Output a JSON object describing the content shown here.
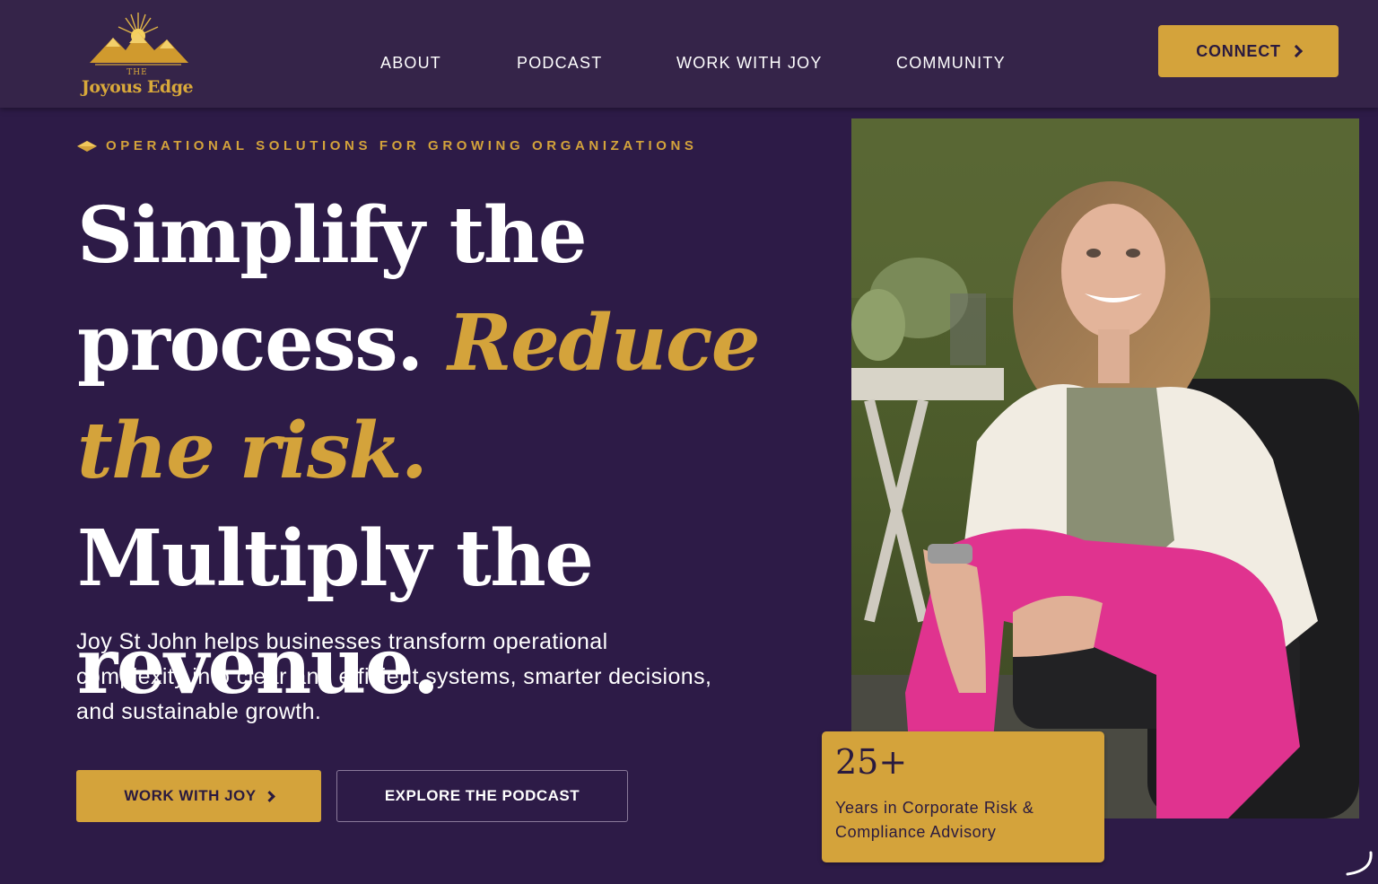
{
  "brand": {
    "logo_the": "THE",
    "logo_name": "Joyous Edge",
    "accent_color": "#d4a33b",
    "background_color": "#2d1b47"
  },
  "nav": {
    "items": [
      {
        "label": "ABOUT"
      },
      {
        "label": "PODCAST"
      },
      {
        "label": "WORK WITH JOY"
      },
      {
        "label": "COMMUNITY"
      }
    ],
    "connect_label": "CONNECT",
    "connect_icon": "chevron-right-icon"
  },
  "hero": {
    "eyebrow": "OPERATIONAL SOLUTIONS FOR GROWING ORGANIZATIONS",
    "eyebrow_icon": "diamond-icon",
    "headline": {
      "part1": "Simplify the process. ",
      "accent": "Reduce the risk.",
      "part2": " Multiply the revenue."
    },
    "lead": "Joy St John helps businesses transform operational complexity into clear and efficient systems, smarter decisions, and sustainable growth.",
    "primary_cta": "WORK WITH JOY",
    "secondary_cta": "EXPLORE THE PODCAST",
    "stat": {
      "number": "25+",
      "label": "Years in Corporate Risk & Compliance Advisory"
    }
  }
}
